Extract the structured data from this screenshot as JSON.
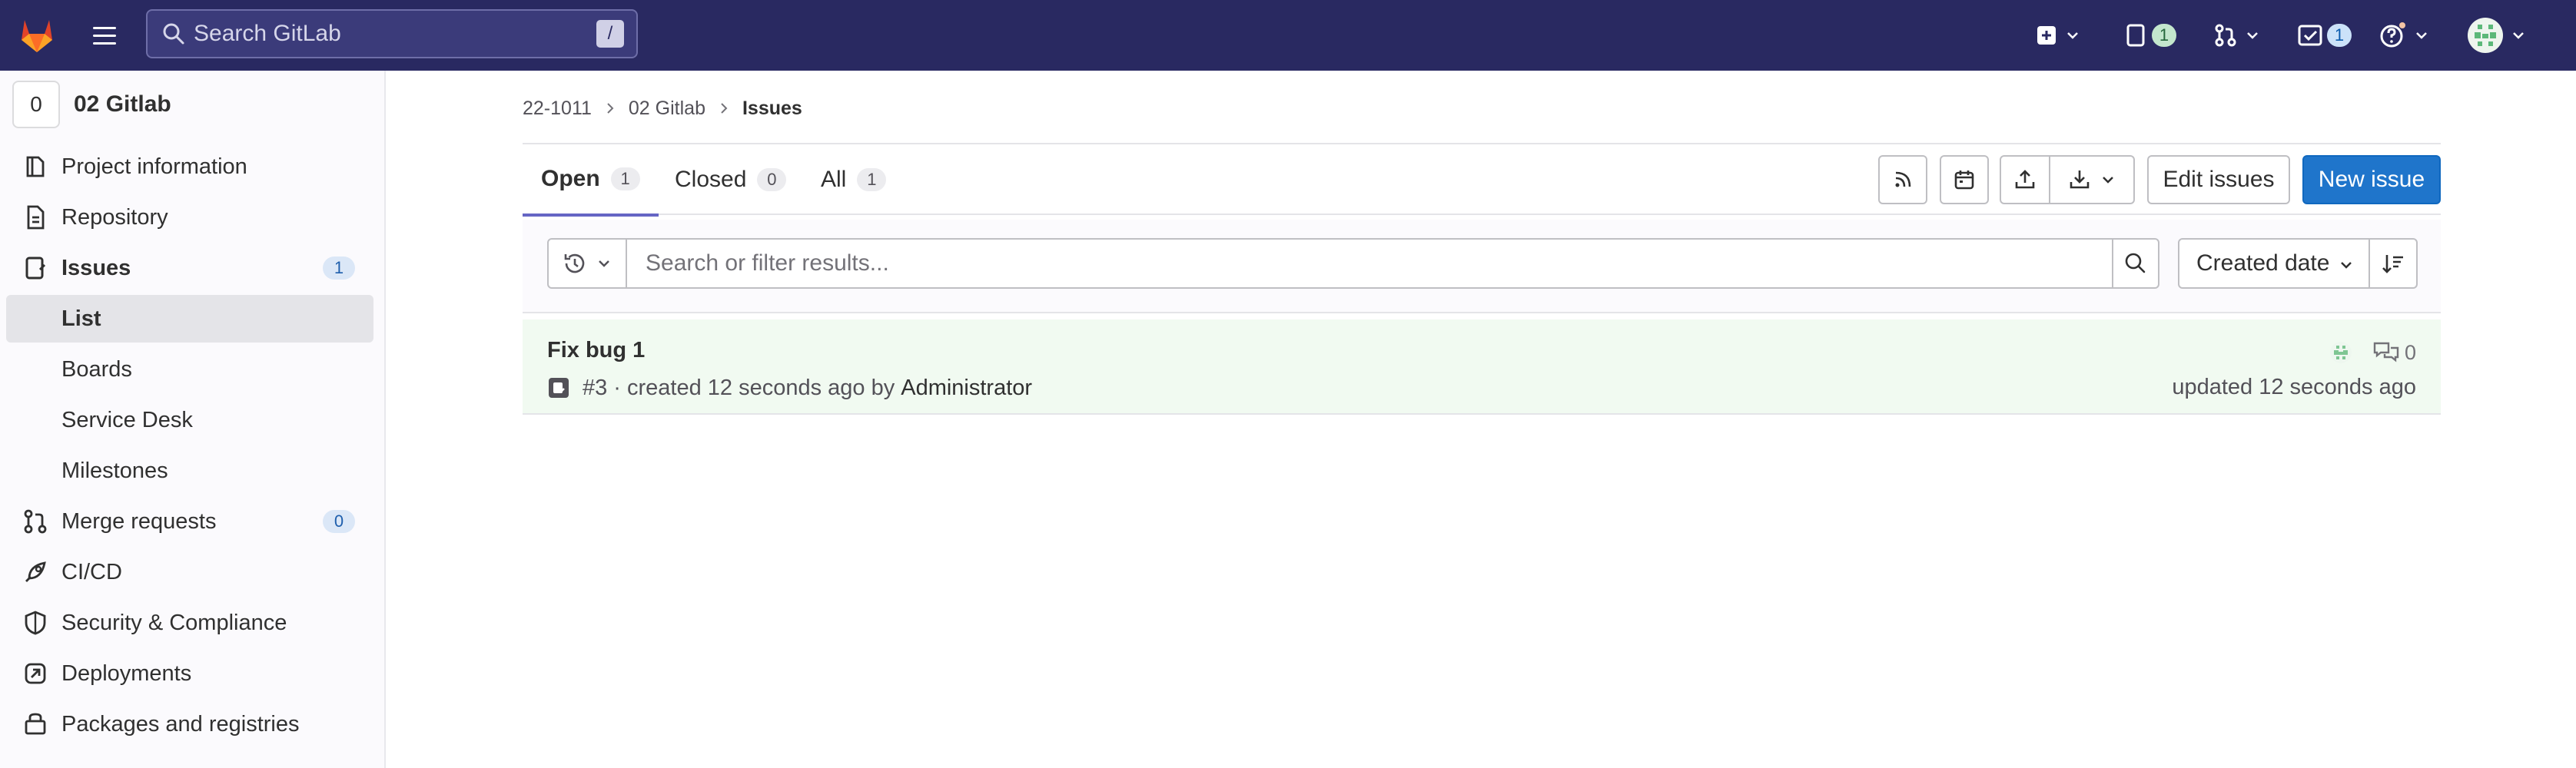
{
  "topbar": {
    "search_placeholder": "Search GitLab",
    "search_shortcut": "/",
    "issues_count": "1",
    "todos_count": "1"
  },
  "sidebar": {
    "project_avatar_letter": "0",
    "project_name": "02 Gitlab",
    "items": [
      {
        "label": "Project information",
        "icon": "project-icon"
      },
      {
        "label": "Repository",
        "icon": "doc-icon"
      },
      {
        "label": "Issues",
        "icon": "issues-icon",
        "count": "1"
      },
      {
        "label": "List"
      },
      {
        "label": "Boards"
      },
      {
        "label": "Service Desk"
      },
      {
        "label": "Milestones"
      },
      {
        "label": "Merge requests",
        "icon": "merge-request-icon",
        "count": "0"
      },
      {
        "label": "CI/CD",
        "icon": "rocket-icon"
      },
      {
        "label": "Security & Compliance",
        "icon": "shield-icon"
      },
      {
        "label": "Deployments",
        "icon": "deployments-icon"
      },
      {
        "label": "Packages and registries",
        "icon": "package-icon"
      }
    ]
  },
  "breadcrumb": {
    "group": "22-1011",
    "project": "02 Gitlab",
    "current": "Issues"
  },
  "tabs": [
    {
      "label": "Open",
      "count": "1"
    },
    {
      "label": "Closed",
      "count": "0"
    },
    {
      "label": "All",
      "count": "1"
    }
  ],
  "actions": {
    "edit_issues": "Edit issues",
    "new_issue": "New issue"
  },
  "filter": {
    "placeholder": "Search or filter results...",
    "sort_label": "Created date"
  },
  "issue": {
    "title": "Fix bug 1",
    "ref": "#3",
    "created_text": "· created 12 seconds ago by",
    "author": "Administrator",
    "comments": "0",
    "updated": "updated 12 seconds ago"
  },
  "colors": {
    "topbar": "#292961",
    "primary": "#1f75cb",
    "tab_active": "#6666c4",
    "issue_row_bg": "#f1faf1"
  }
}
